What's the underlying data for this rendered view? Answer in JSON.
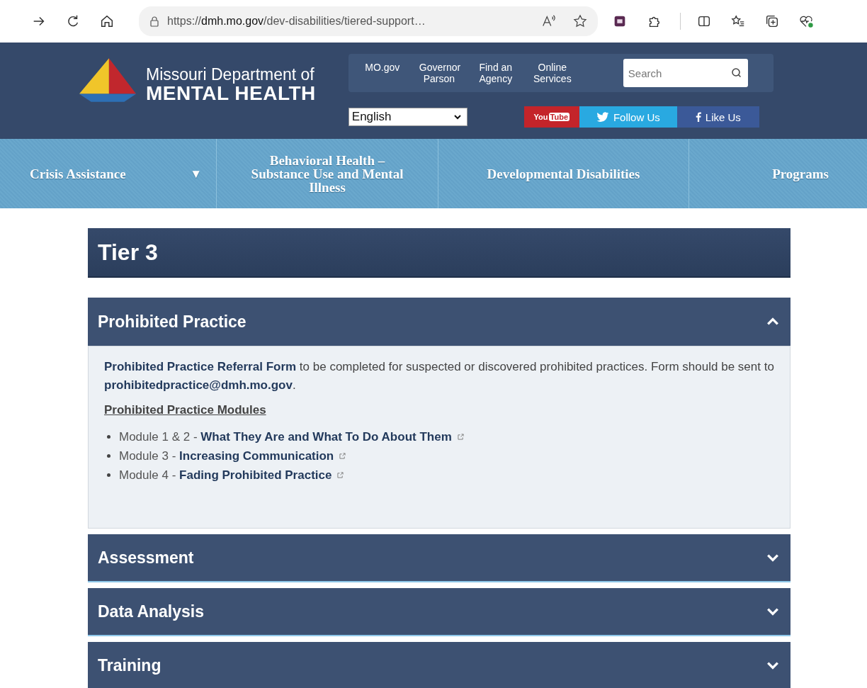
{
  "browser": {
    "url": "https://**dmh.mo.gov**/dev-disabilities/tiered-support…"
  },
  "header": {
    "logo_line1": "Missouri Department of",
    "logo_line2": "MENTAL HEALTH",
    "utility_links": [
      "MO.gov",
      "Governor Parson",
      "Find an Agency",
      "Online Services"
    ],
    "search": {
      "placeholder": "Search"
    },
    "language": {
      "value": "English"
    },
    "social": [
      {
        "kind": "youtube",
        "label": "You",
        "label_2": "Tube"
      },
      {
        "kind": "twitter",
        "label": "Follow Us"
      },
      {
        "kind": "facebook",
        "label": "Like Us"
      }
    ]
  },
  "nav": [
    {
      "label": "Crisis Assistance",
      "caret": "▼"
    },
    {
      "label": "Behavioral Health – Substance Use and Mental Illness"
    },
    {
      "label": "Developmental Disabilities"
    },
    {
      "label": "Programs"
    }
  ],
  "page_title": "Tier 3",
  "accordion": [
    {
      "title": "Prohibited Practice",
      "expanded": true,
      "paragraph": [
        {
          "kind": "link",
          "text": "Prohibited Practice Referral Form"
        },
        {
          "kind": "text",
          "text": " to be completed for suspected or discovered prohibited practices.  Form should be sent to "
        },
        {
          "kind": "link",
          "text": "prohibitedpractice@dmh.mo.gov"
        },
        {
          "kind": "text",
          "text": "."
        }
      ],
      "modules_heading": "Prohibited Practice Modules",
      "modules": [
        {
          "prefix": "Module 1 & 2 - ",
          "link": "What They Are and What To Do About Them"
        },
        {
          "prefix": "Module 3 - ",
          "link": "Increasing Communication"
        },
        {
          "prefix": "Module 4 - ",
          "link": "Fading Prohibited Practice"
        }
      ]
    },
    {
      "title": "Assessment",
      "expanded": false
    },
    {
      "title": "Data Analysis",
      "expanded": false
    },
    {
      "title": "Training",
      "expanded": false
    }
  ]
}
